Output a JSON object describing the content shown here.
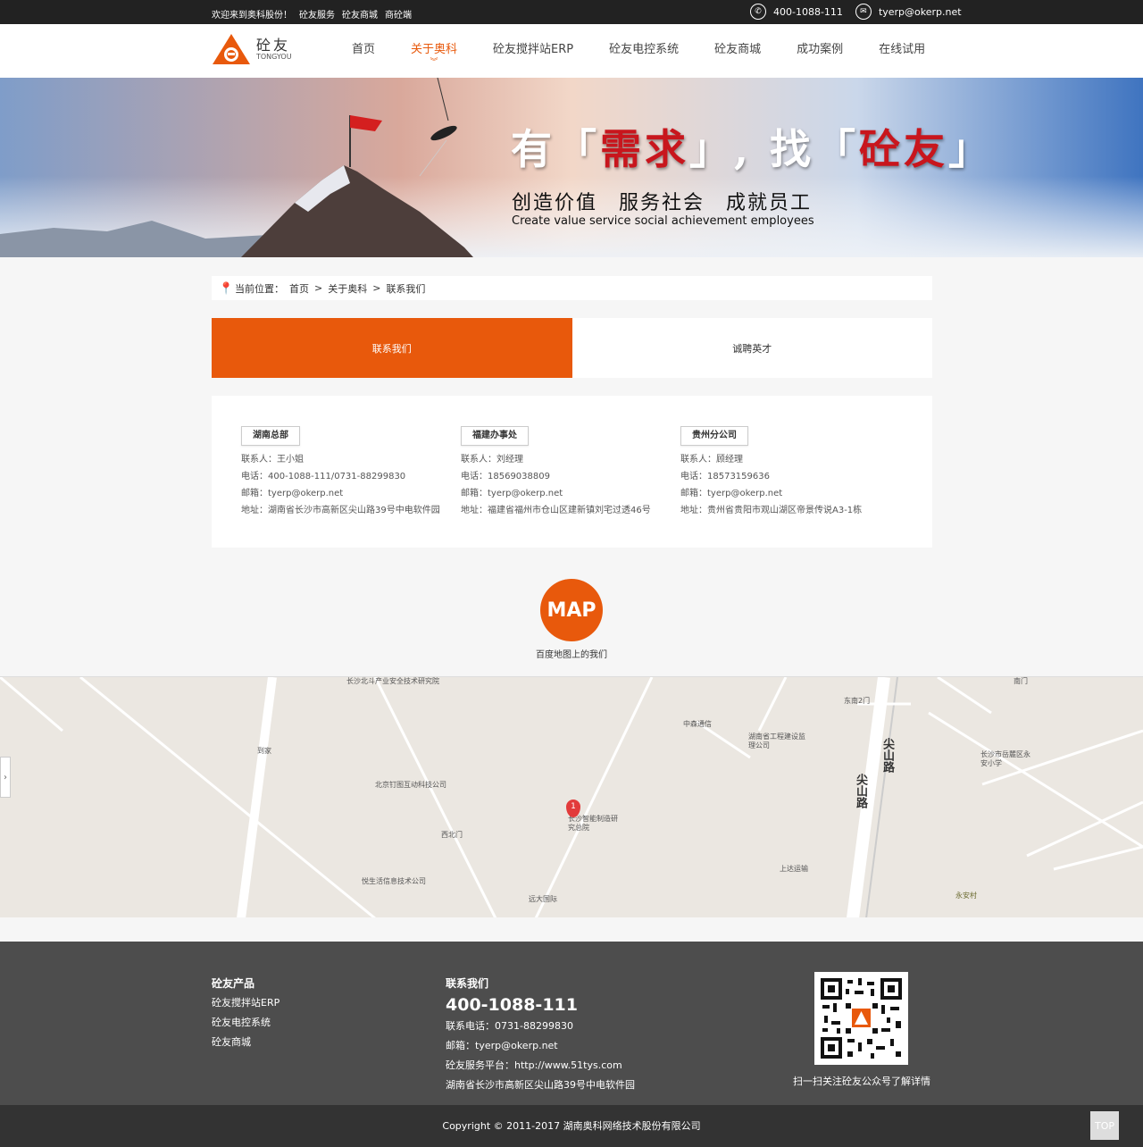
{
  "topbar": {
    "welcome": "欢迎来到奥科股份！",
    "links": [
      "砼友服务",
      "砼友商城",
      "商砼端"
    ],
    "phone": "400-1088-111",
    "email": "tyerp@okerp.net"
  },
  "logo": {
    "cn": "砼友",
    "en": "TONGYOU"
  },
  "nav": [
    "首页",
    "关于奥科",
    "砼友搅拌站ERP",
    "砼友电控系统",
    "砼友商城",
    "成功案例",
    "在线试用"
  ],
  "banner": {
    "slogan_a": "有「",
    "slogan_b": "需求",
    "slogan_c": "」, 找「",
    "slogan_d": "砼友",
    "slogan_e": "」",
    "sub": "创造价值　服务社会　成就员工",
    "en": "Create value service social achievement employees"
  },
  "breadcrumb": {
    "prefix": "当前位置：",
    "items": [
      "首页",
      ">",
      "关于奥科",
      ">",
      "联系我们"
    ]
  },
  "tabs": [
    "联系我们",
    "诚聘英才"
  ],
  "offices": [
    {
      "name": "湖南总部",
      "contact": "联系人：王小姐",
      "tel": "电话：400-1088-111/0731-88299830",
      "email": "邮箱：tyerp@okerp.net",
      "addr": "地址：湖南省长沙市高新区尖山路39号中电软件园"
    },
    {
      "name": "福建办事处",
      "contact": "联系人：刘经理",
      "tel": "电话：18569038809",
      "email": "邮箱：tyerp@okerp.net",
      "addr": "地址：福建省福州市仓山区建新镇刘宅过透46号"
    },
    {
      "name": "贵州分公司",
      "contact": "联系人：顾经理",
      "tel": "电话：18573159636",
      "email": "邮箱：tyerp@okerp.net",
      "addr": "地址：贵州省贵阳市观山湖区帝景传说A3-1栋"
    }
  ],
  "map_section": {
    "icon_text": "MAP",
    "caption": "百度地图上的我们"
  },
  "map": {
    "pois": [
      "长沙北斗产业安全技术研究院",
      "到家",
      "北京钉图互动科技公司",
      "西北门",
      "悦生活信息技术公司",
      "远大国际",
      "长沙智能制造研究总院",
      "中森通信",
      "湖南省工程建设监理公司",
      "东南2门",
      "长沙市岳麓区永安小学",
      "上达运输",
      "永安村",
      "南门"
    ],
    "road": "尖山路",
    "marker": "1"
  },
  "footer": {
    "products_title": "砼友产品",
    "products": [
      "砼友搅拌站ERP",
      "砼友电控系统",
      "砼友商城"
    ],
    "contact_title": "联系我们",
    "phone": "400-1088-111",
    "tel": "联系电话：0731-88299830",
    "email": "邮箱：tyerp@okerp.net",
    "platform": "砼友服务平台：http://www.51tys.com",
    "addr": "湖南省长沙市高新区尖山路39号中电软件园",
    "qr_caption": "扫一扫关注砼友公众号了解详情"
  },
  "copyright": "Copyright © 2011-2017 湖南奥科网络技术股份有限公司",
  "totop": "TOP",
  "colors": {
    "accent": "#e8590c",
    "topbar": "#222222",
    "footer": "#4d4d4d"
  }
}
